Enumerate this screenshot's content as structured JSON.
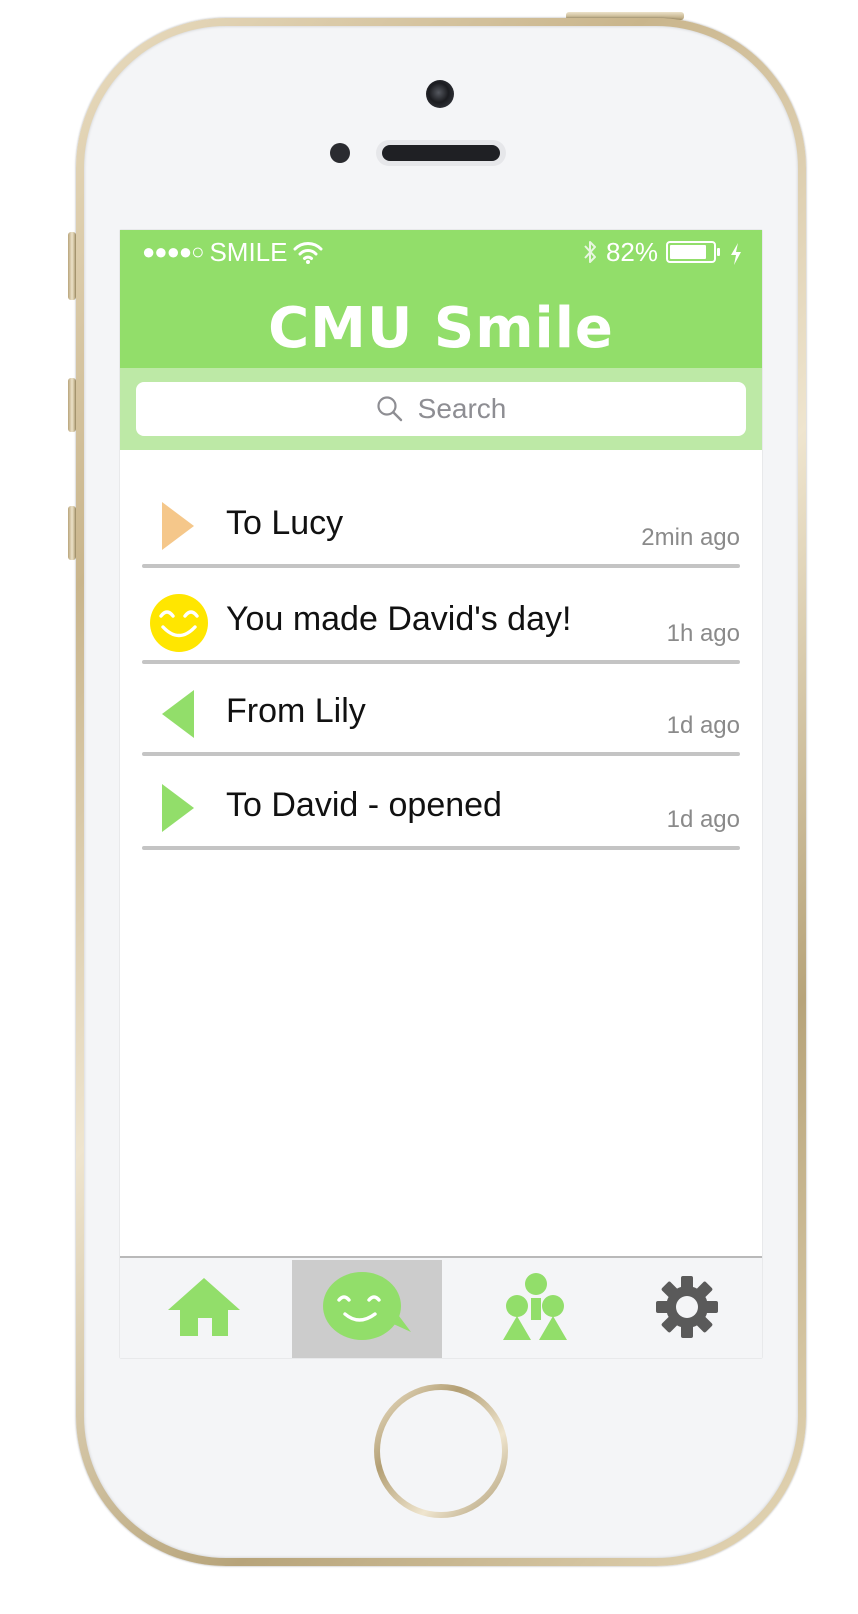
{
  "status_bar": {
    "signal": "●●●●○",
    "carrier": "SMILE",
    "battery_percent": "82%"
  },
  "app": {
    "title": "CMU Smile",
    "brand_color": "#92de6a"
  },
  "search": {
    "placeholder": "Search"
  },
  "messages": [
    {
      "icon": "outgoing-arrow-icon",
      "icon_color": "#f5c78a",
      "title": "To Lucy",
      "time": "2min ago"
    },
    {
      "icon": "smiley-face-icon",
      "icon_color": "#ffe600",
      "title": "You made David's day!",
      "time": "1h ago"
    },
    {
      "icon": "incoming-arrow-icon",
      "icon_color": "#92de6a",
      "title": "From Lily",
      "time": "1d ago"
    },
    {
      "icon": "outgoing-arrow-icon",
      "icon_color": "#92de6a",
      "title": "To David - opened",
      "time": "1d ago"
    }
  ],
  "tabs": [
    {
      "icon": "home-icon",
      "active": false
    },
    {
      "icon": "smile-chat-icon",
      "active": true
    },
    {
      "icon": "people-icon",
      "active": false
    },
    {
      "icon": "gear-icon",
      "active": false
    }
  ]
}
